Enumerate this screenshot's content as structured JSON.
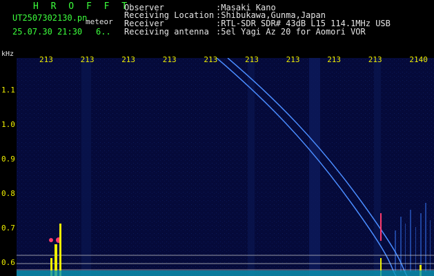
{
  "header": {
    "brand": "H R O F F T",
    "filename": "UT2507302130.pn",
    "filename_suffix": "meteor",
    "timestamp": "25.07.30 21:30",
    "timestamp_extra": "6..",
    "rows": [
      {
        "label": "Observer",
        "value": ":Masaki Kano"
      },
      {
        "label": "Receiving Location",
        "value": ":Shibukawa,Gunma,Japan"
      },
      {
        "label": "Receiver",
        "value": ":RTL-SDR SDR# 43dB L15 114.1MHz USB"
      },
      {
        "label": "Receiving antenna",
        "value": ":5el Yagi Az 20 for Aomori VOR"
      }
    ]
  },
  "colors": {
    "background": "#000000",
    "plot_background": "#050a3a",
    "header_text": "#e6e6e6",
    "brand_text": "#3cff3c",
    "axis_text": "#f0f000",
    "trace": "#4a8cff",
    "meteor": "#ff3a6a"
  },
  "spectrogram": {
    "y_unit_label": "kHz",
    "x_tick_labels": [
      "213",
      "213",
      "213",
      "213",
      "213",
      "213",
      "213",
      "213",
      "213",
      "2140"
    ],
    "y_tick_labels": [
      "1.1",
      "1.0",
      "0.9",
      "0.8",
      "0.7",
      "0.6"
    ],
    "y_tick_values": [
      1.1,
      1.0,
      0.9,
      0.8,
      0.7,
      0.6
    ]
  }
}
